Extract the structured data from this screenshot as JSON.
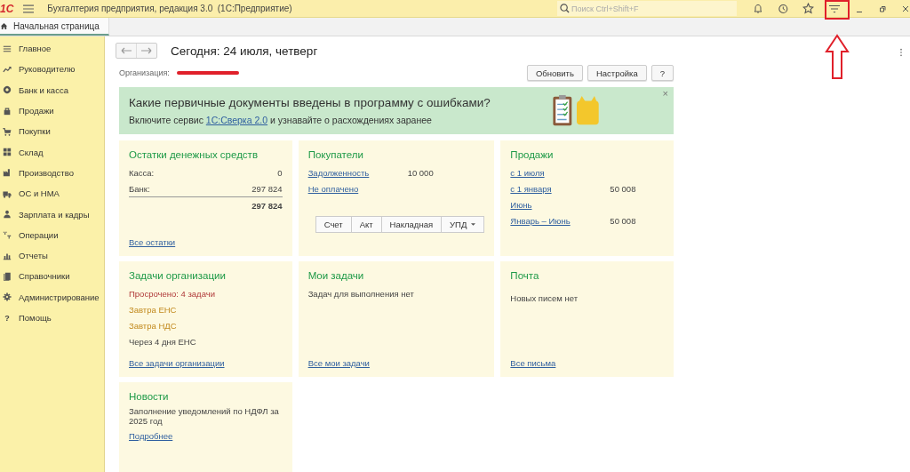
{
  "app": {
    "logo": "1С",
    "title": "Бухгалтерия предприятия, редакция 3.0  (1С:Предприятие)",
    "search_placeholder": "Поиск Ctrl+Shift+F"
  },
  "tabs": [
    {
      "label": "Начальная страница",
      "selected": true
    }
  ],
  "sidebar": {
    "items": [
      {
        "label": "Главное"
      },
      {
        "label": "Руководителю"
      },
      {
        "label": "Банк и касса"
      },
      {
        "label": "Продажи"
      },
      {
        "label": "Покупки"
      },
      {
        "label": "Склад"
      },
      {
        "label": "Производство"
      },
      {
        "label": "ОС и НМА"
      },
      {
        "label": "Зарплата и кадры"
      },
      {
        "label": "Операции"
      },
      {
        "label": "Отчеты"
      },
      {
        "label": "Справочники"
      },
      {
        "label": "Администрирование"
      },
      {
        "label": "Помощь",
        "glyph": "?"
      }
    ]
  },
  "page": {
    "title": "Сегодня: 24 июля, четверг",
    "org_label": "Организация:",
    "buttons": [
      "Обновить",
      "Настройка",
      "?"
    ]
  },
  "banner": {
    "heading": "Какие первичные документы введены в программу с ошибками?",
    "text_before": "Включите сервис",
    "link": "1С:Сверка 2.0",
    "text_after": "и узнавайте о расхождениях заранее",
    "close": "×"
  },
  "cards": [
    {
      "title": "Остатки денежных средств",
      "lines": [
        {
          "kind": "pair",
          "label": "Касса:",
          "value": "0"
        },
        {
          "kind": "pair",
          "label": "Банк:",
          "value": "297 824"
        },
        {
          "kind": "total",
          "value": "297 824"
        }
      ],
      "footer": "Все остатки"
    },
    {
      "title": "Покупатели",
      "lines": [
        {
          "kind": "link-value",
          "label": "Задолженность",
          "value": "10 000"
        },
        {
          "kind": "link",
          "label": "Не оплачено"
        },
        {
          "kind": "buttons",
          "items": [
            {
              "label": "Счет",
              "menu": false
            },
            {
              "label": "Акт",
              "menu": false
            },
            {
              "label": "Накладная",
              "menu": false
            },
            {
              "label": "УПД",
              "menu": true
            }
          ]
        }
      ]
    },
    {
      "title": "Продажи",
      "lines": [
        {
          "kind": "link",
          "label": "с 1 июля"
        },
        {
          "kind": "link-value",
          "label": "с 1 января",
          "value": "50 008"
        },
        {
          "kind": "link",
          "label": "Июнь"
        },
        {
          "kind": "link-value",
          "label": "Январь – Июнь",
          "value": "50 008"
        }
      ]
    },
    {
      "title": "Задачи организации",
      "lines": [
        {
          "kind": "overdue",
          "label": "Просрочено: 4 задачи"
        },
        {
          "kind": "due",
          "label": "Завтра ЕНС"
        },
        {
          "kind": "due",
          "label": "Завтра НДС"
        },
        {
          "kind": "text",
          "label": "Через 4 дня ЕНС"
        }
      ],
      "footer": "Все задачи организации"
    },
    {
      "title": "Мои задачи",
      "lines": [
        {
          "kind": "text",
          "label": "Задач для выполнения нет"
        }
      ],
      "footer": "Все мои задачи"
    },
    {
      "title": "Почта",
      "lines": [
        {
          "kind": "gap"
        },
        {
          "kind": "text",
          "label": "Новых писем нет"
        }
      ],
      "footer": "Все письма"
    },
    {
      "title": "Новости",
      "lines": [
        {
          "kind": "text",
          "label": "Заполнение уведомлений по НДФЛ за 2025 год"
        },
        {
          "kind": "link",
          "label": "Подробнее"
        }
      ]
    }
  ]
}
